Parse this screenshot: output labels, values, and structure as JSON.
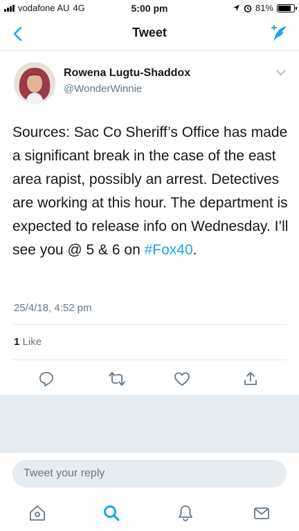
{
  "status_bar": {
    "carrier": "vodafone AU",
    "network": "4G",
    "time": "5:00 pm",
    "battery": "81%",
    "battery_level": 0.81
  },
  "nav": {
    "title": "Tweet",
    "back_icon": "chevron-left-icon",
    "compose_icon": "compose-tweet-icon"
  },
  "tweet": {
    "author_name": "Rowena Lugtu-Shaddox",
    "author_handle": "@WonderWinnie",
    "text": "Sources: Sac Co Sheriff’s Office has made a significant break in the case of the east area rapist, possibly an arrest. Detectives are working at this hour. The department is expected to release info on Wednesday. I’ll see you @ 5 & 6 on ",
    "hashtag": "#Fox40",
    "text_end": ".",
    "timestamp": "25/4/18, 4:52 pm",
    "like_count": "1",
    "like_label": "Like"
  },
  "colors": {
    "accent": "#1da1f2",
    "secondary_text": "#657786",
    "divider": "#e1e8ed",
    "background_gray": "#e6ecf0"
  },
  "reply": {
    "placeholder": "Tweet your reply"
  },
  "tabbar": {
    "items": [
      "home-icon",
      "search-icon",
      "notifications-icon",
      "messages-icon"
    ]
  }
}
